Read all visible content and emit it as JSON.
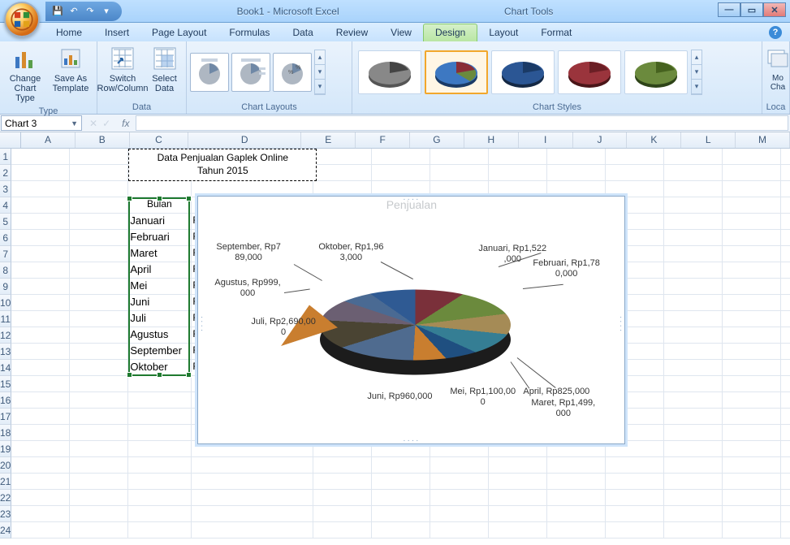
{
  "window": {
    "title": "Book1 - Microsoft Excel",
    "context_title": "Chart Tools"
  },
  "qat": {
    "save": "💾",
    "undo": "↶",
    "redo": "↷",
    "dd": "▾"
  },
  "tabs": {
    "home": "Home",
    "insert": "Insert",
    "page_layout": "Page Layout",
    "formulas": "Formulas",
    "data": "Data",
    "review": "Review",
    "view": "View",
    "design": "Design",
    "layout": "Layout",
    "format": "Format"
  },
  "ribbon": {
    "type_group": "Type",
    "change_chart_type": "Change Chart Type",
    "save_as_template": "Save As Template",
    "data_group": "Data",
    "switch_row_col": "Switch Row/Column",
    "select_data": "Select Data",
    "chart_layouts": "Chart Layouts",
    "chart_styles": "Chart Styles",
    "move_chart": "Mo Cha",
    "location": "Loca"
  },
  "namebox": "Chart 3",
  "fx": "fx",
  "columns": [
    "A",
    "B",
    "C",
    "D",
    "E",
    "F",
    "G",
    "H",
    "I",
    "J",
    "K",
    "L",
    "M"
  ],
  "rows": [
    1,
    2,
    3,
    4,
    5,
    6,
    7,
    8,
    9,
    10,
    11,
    12,
    13,
    14,
    15,
    16,
    17,
    18,
    19,
    20,
    21,
    22,
    23,
    24
  ],
  "sheet": {
    "title_line1": "Data Penjualan Gaplek Online",
    "title_line2": "Tahun 2015",
    "header_bulan": "Bulan",
    "header_penjualan": "Penjualan",
    "months": [
      "Januari",
      "Februari",
      "Maret",
      "April",
      "Mei",
      "Juni",
      "Juli",
      "Agustus",
      "September",
      "Oktober"
    ],
    "col_d_prefix": "R"
  },
  "chart_data": {
    "type": "pie",
    "title": "Penjualan",
    "categories": [
      "Januari",
      "Februari",
      "Maret",
      "April",
      "Mei",
      "Juni",
      "Juli",
      "Agustus",
      "September",
      "Oktober"
    ],
    "values": [
      1522000,
      1780000,
      1499000,
      825000,
      1100000,
      960000,
      2690000,
      999000,
      789000,
      1963000
    ],
    "labels": [
      "Januari,  Rp1,522,000",
      "Februari,  Rp1,780,000",
      "Maret,  Rp1,499,000",
      "April,  Rp825,000",
      "Mei,  Rp1,100,000",
      "Juni,  Rp960,000",
      "Juli,  Rp2,690,000",
      "Agustus,  Rp999,000",
      "September,  Rp789,000",
      "Oktober,  Rp1,963,000"
    ],
    "label_display": {
      "jan": "Januari,  Rp1,522\n,000",
      "feb": "Februari,  Rp1,78\n0,000",
      "mar": "Maret,  Rp1,499,\n000",
      "apr": "April,  Rp825,000",
      "mei": "Mei,  Rp1,100,00\n0",
      "jun": "Juni,  Rp960,000",
      "jul": "Juli,  Rp2,690,00\n0",
      "agu": "Agustus,  Rp999,\n000",
      "sep": "September,  Rp7\n89,000",
      "okt": "Oktober,  Rp1,96\n3,000"
    }
  }
}
